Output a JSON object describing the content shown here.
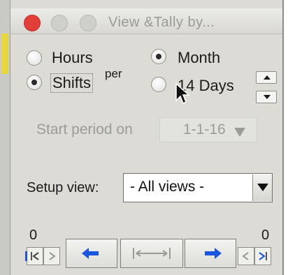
{
  "window": {
    "title": "View &Tally by..."
  },
  "period_unit": {
    "options": [
      {
        "label": "Hours",
        "selected": false
      },
      {
        "label": "Shifts",
        "selected": true
      }
    ]
  },
  "per_label": "per",
  "period_length": {
    "options": [
      {
        "label": "Month",
        "selected": true
      },
      {
        "label": "14 Days",
        "selected": false
      }
    ]
  },
  "start_period": {
    "label": "Start period on",
    "value": "1-1-16"
  },
  "setup_view": {
    "label": "Setup view:",
    "value": "- All views -"
  },
  "navigation": {
    "left_count": "0",
    "right_count": "0"
  },
  "icons": {
    "step_prev": "step-back-icon",
    "step_next": "step-forward-icon",
    "prev": "arrow-left-icon",
    "fit": "fit-range-icon",
    "next": "arrow-right-icon"
  },
  "colors": {
    "close": "#e23f3a",
    "arrow_accent": "#1a56e0",
    "selection_strip": "#e7d640"
  }
}
